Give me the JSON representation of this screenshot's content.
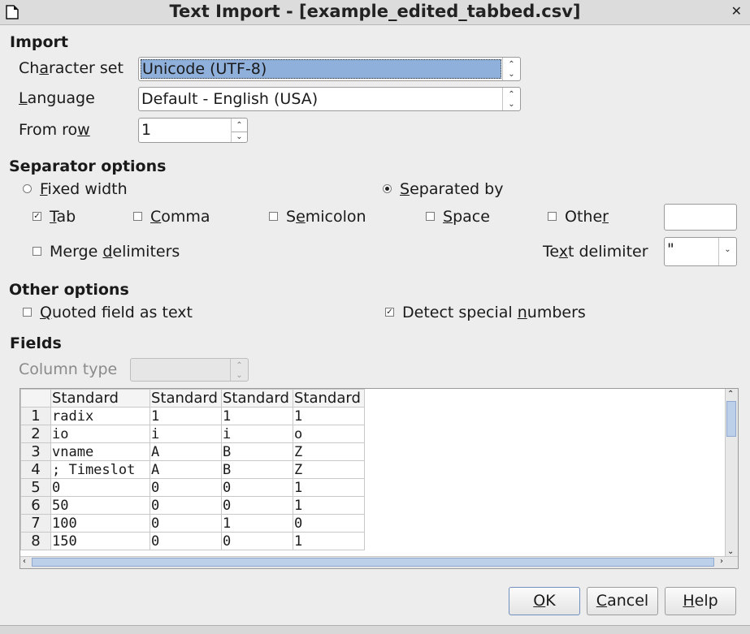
{
  "window": {
    "title": "Text Import - [example_edited_tabbed.csv]"
  },
  "import": {
    "heading": "Import",
    "charset_label_pre": "Ch",
    "charset_label_ul": "a",
    "charset_label_post": "racter set",
    "charset_value": "Unicode (UTF-8)",
    "language_label_ul": "L",
    "language_label_post": "anguage",
    "language_value": "Default - English (USA)",
    "fromrow_label_pre": "From ro",
    "fromrow_label_ul": "w",
    "fromrow_value": "1"
  },
  "separator": {
    "heading": "Separator options",
    "fixed_ul": "F",
    "fixed_post": "ixed width",
    "separated_ul": "S",
    "separated_post": "eparated by",
    "tab_ul": "T",
    "tab_post": "ab",
    "comma_ul": "C",
    "comma_post": "omma",
    "semicolon_pre": "S",
    "semicolon_ul": "e",
    "semicolon_post": "micolon",
    "space_ul": "S",
    "space_post": "pace",
    "other_pre": "Othe",
    "other_ul": "r",
    "other_post": "",
    "other_value": "",
    "merge_pre": "Merge ",
    "merge_ul": "d",
    "merge_post": "elimiters",
    "textdelim_pre": "Te",
    "textdelim_ul": "x",
    "textdelim_post": "t delimiter",
    "textdelim_value": "\"",
    "tab_checked": true,
    "comma_checked": false,
    "semicolon_checked": false,
    "space_checked": false,
    "other_checked": false,
    "merge_checked": false,
    "separated_selected": true
  },
  "other_options": {
    "heading": "Other options",
    "quoted_ul": "Q",
    "quoted_post": "uoted field as text",
    "detect_pre": "Detect special ",
    "detect_ul": "n",
    "detect_post": "umbers",
    "quoted_checked": false,
    "detect_checked": true
  },
  "fields": {
    "heading": "Fields",
    "coltype_label": "Column type",
    "headers": [
      "Standard",
      "Standard",
      "Standard",
      "Standard"
    ],
    "rows": [
      {
        "n": "1",
        "c": [
          "radix",
          "1",
          "1",
          "1"
        ]
      },
      {
        "n": "2",
        "c": [
          "io",
          "i",
          "i",
          "o"
        ]
      },
      {
        "n": "3",
        "c": [
          "vname",
          "A",
          "B",
          "Z"
        ]
      },
      {
        "n": "4",
        "c": [
          "; Timeslot",
          "A",
          "B",
          "Z"
        ]
      },
      {
        "n": "5",
        "c": [
          "0",
          "0",
          "0",
          "1"
        ]
      },
      {
        "n": "6",
        "c": [
          "50",
          "0",
          "0",
          "1"
        ]
      },
      {
        "n": "7",
        "c": [
          "100",
          "0",
          "1",
          "0"
        ]
      },
      {
        "n": "8",
        "c": [
          "150",
          "0",
          "0",
          "1"
        ]
      }
    ]
  },
  "buttons": {
    "ok_ul": "O",
    "ok_post": "K",
    "cancel_ul": "C",
    "cancel_post": "ancel",
    "help_ul": "H",
    "help_post": "elp"
  },
  "icons": {
    "close": "close-icon",
    "document": "document-icon"
  }
}
